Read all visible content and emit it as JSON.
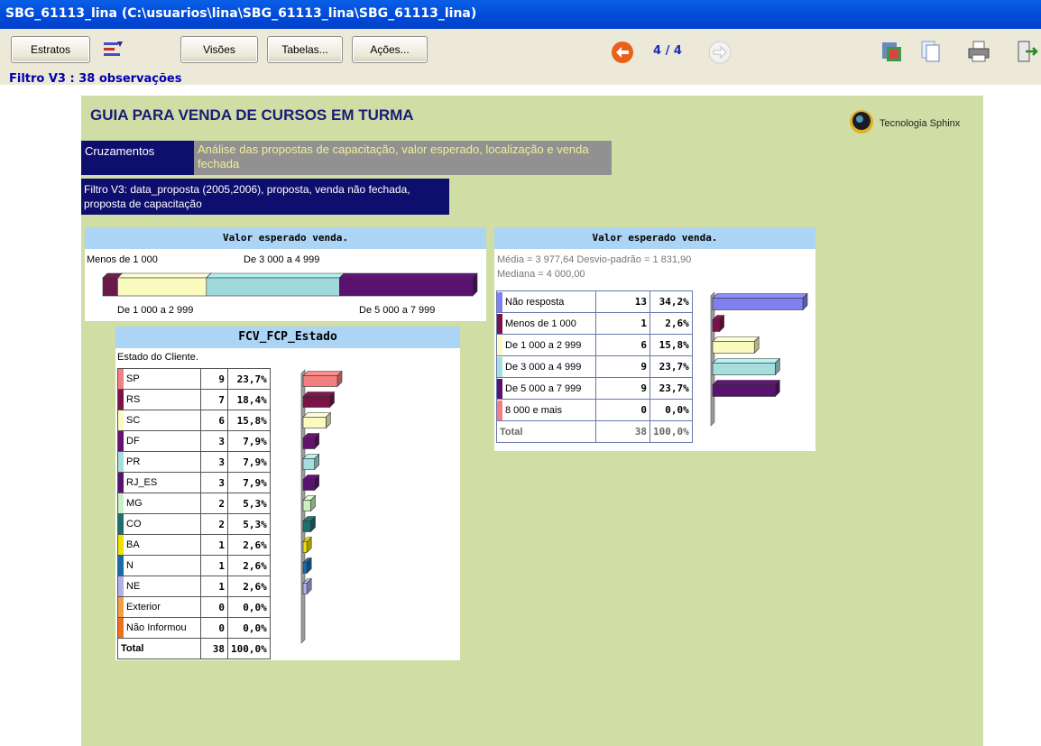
{
  "window": {
    "title": "SBG_61113_lina (C:\\usuarios\\lina\\SBG_61113_lina\\SBG_61113_lina)"
  },
  "toolbar": {
    "estratos": "Estratos",
    "visoes": "Visões",
    "tabelas": "Tabelas...",
    "acoes": "Ações...",
    "page_counter": "4 / 4",
    "filter_label": "Filtro V3 : 38 observações"
  },
  "doc": {
    "title": "GUIA PARA VENDA DE CURSOS EM TURMA",
    "logo_text": "Tecnologia Sphinx",
    "cruzamentos": "Cruzamentos",
    "cruz_desc": "Análise das propostas de capacitação, valor esperado, localização e venda fechada",
    "filter_box": "Filtro V3: data_proposta (2005,2006), proposta, venda não fechada, proposta de capacitação"
  },
  "valor_bar": {
    "title": "Valor esperado venda.",
    "labels_top": [
      "Menos de 1 000",
      "De 3 000 a 4 999"
    ],
    "labels_bottom": [
      "De 1 000 a 2 999",
      "De 5 000 a 7 999"
    ],
    "segments": [
      {
        "label": "Menos de 1 000",
        "value": 1,
        "color": "#6a1a4a"
      },
      {
        "label": "De 1 000 a 2 999",
        "value": 6,
        "color": "#fbfbc0"
      },
      {
        "label": "De 3 000 a 4 999",
        "value": 9,
        "color": "#9fd9d9"
      },
      {
        "label": "De 5 000 a 7 999",
        "value": 9,
        "color": "#5a1270"
      }
    ]
  },
  "estado": {
    "title": "FCV_FCP_Estado",
    "subtitle": "Estado do Cliente.",
    "rows": [
      {
        "label": "SP",
        "n": "9",
        "pct": "23,7%",
        "value": 23.7,
        "color": "#f38080"
      },
      {
        "label": "RS",
        "n": "7",
        "pct": "18,4%",
        "value": 18.4,
        "color": "#7a1448"
      },
      {
        "label": "SC",
        "n": "6",
        "pct": "15,8%",
        "value": 15.8,
        "color": "#fbfbc0"
      },
      {
        "label": "DF",
        "n": "3",
        "pct": "7,9%",
        "value": 7.9,
        "color": "#64126e"
      },
      {
        "label": "PR",
        "n": "3",
        "pct": "7,9%",
        "value": 7.9,
        "color": "#a6dddd"
      },
      {
        "label": "RJ_ES",
        "n": "3",
        "pct": "7,9%",
        "value": 7.9,
        "color": "#5a1270"
      },
      {
        "label": "MG",
        "n": "2",
        "pct": "5,3%",
        "value": 5.3,
        "color": "#c8f0c0"
      },
      {
        "label": "CO",
        "n": "2",
        "pct": "5,3%",
        "value": 5.3,
        "color": "#1e6e6e"
      },
      {
        "label": "BA",
        "n": "1",
        "pct": "2,6%",
        "value": 2.6,
        "color": "#f0e000"
      },
      {
        "label": "N",
        "n": "1",
        "pct": "2,6%",
        "value": 2.6,
        "color": "#1a6aa8"
      },
      {
        "label": "NE",
        "n": "1",
        "pct": "2,6%",
        "value": 2.6,
        "color": "#b0b0e8"
      },
      {
        "label": "Exterior",
        "n": "0",
        "pct": "0,0%",
        "value": 0,
        "color": "#f0a040"
      },
      {
        "label": "Não Informou",
        "n": "0",
        "pct": "0,0%",
        "value": 0,
        "color": "#f07020"
      }
    ],
    "total": {
      "label": "Total",
      "n": "38",
      "pct": "100,0%"
    }
  },
  "valor_table": {
    "title": "Valor esperado venda.",
    "stats_line1": "Média = 3 977,64  Desvio-padrão = 1 831,90",
    "stats_line2": "Mediana = 4 000,00",
    "rows": [
      {
        "label": "Não resposta",
        "n": "13",
        "pct": "34,2%",
        "value": 34.2,
        "color": "#8080f0"
      },
      {
        "label": "Menos de 1 000",
        "n": "1",
        "pct": "2,6%",
        "value": 2.6,
        "color": "#7a1448"
      },
      {
        "label": "De 1 000 a 2 999",
        "n": "6",
        "pct": "15,8%",
        "value": 15.8,
        "color": "#fbfbc0"
      },
      {
        "label": "De 3 000 a 4 999",
        "n": "9",
        "pct": "23,7%",
        "value": 23.7,
        "color": "#a6dddd"
      },
      {
        "label": "De 5 000 a 7 999",
        "n": "9",
        "pct": "23,7%",
        "value": 23.7,
        "color": "#5a1270"
      },
      {
        "label": "8 000 e mais",
        "n": "0",
        "pct": "0,0%",
        "value": 0,
        "color": "#f38080"
      }
    ],
    "total": {
      "label": "Total",
      "n": "38",
      "pct": "100,0%"
    }
  }
}
